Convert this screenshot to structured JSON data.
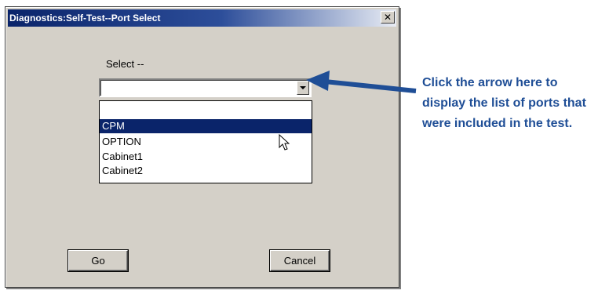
{
  "window": {
    "title": "Diagnostics:Self-Test--Port Select",
    "close_glyph": "✕"
  },
  "form": {
    "select_label": "Select --",
    "combo_value": "",
    "options": [
      {
        "label": ""
      },
      {
        "label": "CPM",
        "selected": true
      },
      {
        "label": "OPTION"
      },
      {
        "label": "Cabinet1"
      },
      {
        "label": "Cabinet2"
      }
    ]
  },
  "buttons": {
    "go": "Go",
    "cancel": "Cancel"
  },
  "annotation": {
    "text": "Click the arrow here to display the list of ports that were included in the test.",
    "color": "#1f4e96"
  },
  "colors": {
    "dialog_bg": "#d4d0c8",
    "title_bar": "#0a246a",
    "selection": "#0a246a"
  },
  "icons": {
    "dropdown_arrow": "chevron-down-icon",
    "pointer": "mouse-pointer-icon",
    "callout_arrow": "arrow-left-icon"
  }
}
